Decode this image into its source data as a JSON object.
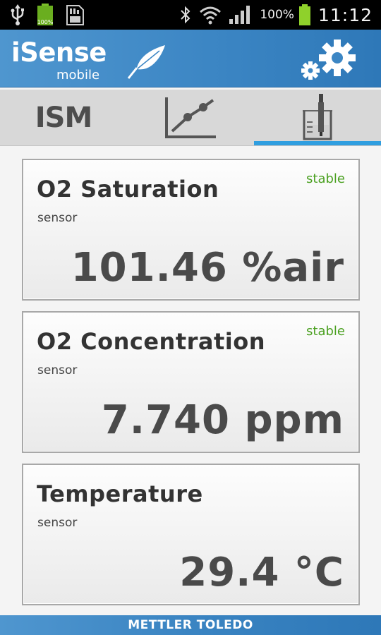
{
  "status_bar": {
    "left_icons": [
      "usb-icon",
      "battery-full-notification-icon",
      "sd-card-icon"
    ],
    "right_icons": [
      "bluetooth-icon",
      "wifi-icon",
      "cellular-signal-icon",
      "battery-icon"
    ],
    "battery_percent": "100%",
    "time": "11:12"
  },
  "header": {
    "app_name": "iSense",
    "app_subtitle": "mobile",
    "logo_icon": "feather-icon",
    "settings_icon": "gears-icon",
    "colors": {
      "background": "#3c86c4"
    }
  },
  "tabs": [
    {
      "label": "ISM",
      "icon": null,
      "active": false
    },
    {
      "label": "",
      "icon": "chart-icon",
      "active": false
    },
    {
      "label": "",
      "icon": "sensor-beaker-icon",
      "active": true
    }
  ],
  "tab_indicator_color": "#2f9ee0",
  "cards": [
    {
      "title": "O2 Saturation",
      "subtitle": "sensor",
      "status": "stable",
      "value": "101.46 %air"
    },
    {
      "title": "O2 Concentration",
      "subtitle": "sensor",
      "status": "stable",
      "value": "7.740 ppm"
    },
    {
      "title": "Temperature",
      "subtitle": "sensor",
      "status": "",
      "value": "29.4 °C"
    }
  ],
  "status_color": "#4aa020",
  "footer": {
    "brand": "METTLER TOLEDO"
  }
}
